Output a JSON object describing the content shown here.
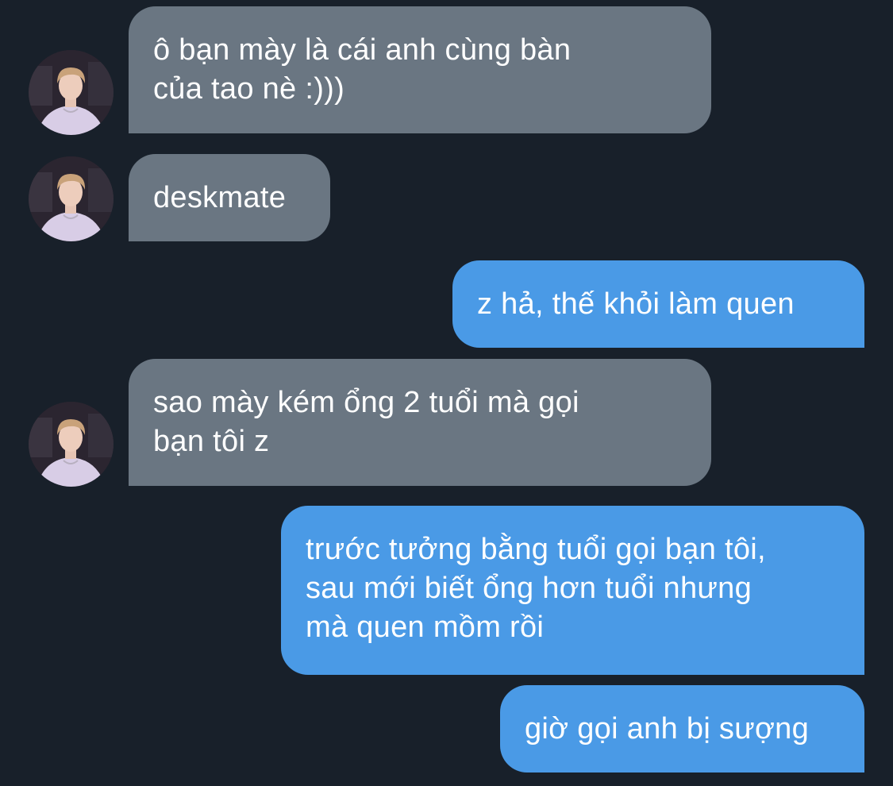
{
  "conversation": {
    "messages": [
      {
        "sender": "them",
        "text": "ô bạn mày là cái anh cùng bàn\ncủa tao nè :)))"
      },
      {
        "sender": "them",
        "text": "deskmate"
      },
      {
        "sender": "me",
        "text": "z hả, thế khỏi làm quen"
      },
      {
        "sender": "them",
        "text": "sao mày kém ổng 2 tuổi mà gọi\nbạn tôi z"
      },
      {
        "sender": "me",
        "text": "trước tưởng bằng tuổi gọi bạn tôi,\nsau mới biết ổng hơn tuổi nhưng\nmà quen mồm rồi"
      },
      {
        "sender": "me",
        "text": "giờ gọi anh bị sượng"
      }
    ]
  },
  "colors": {
    "background": "#18202a",
    "incoming_bubble": "#6a7682",
    "outgoing_bubble": "#4a9ae6",
    "text": "#ffffff"
  },
  "icons": {
    "contact_avatar": "contact-avatar-photo"
  }
}
